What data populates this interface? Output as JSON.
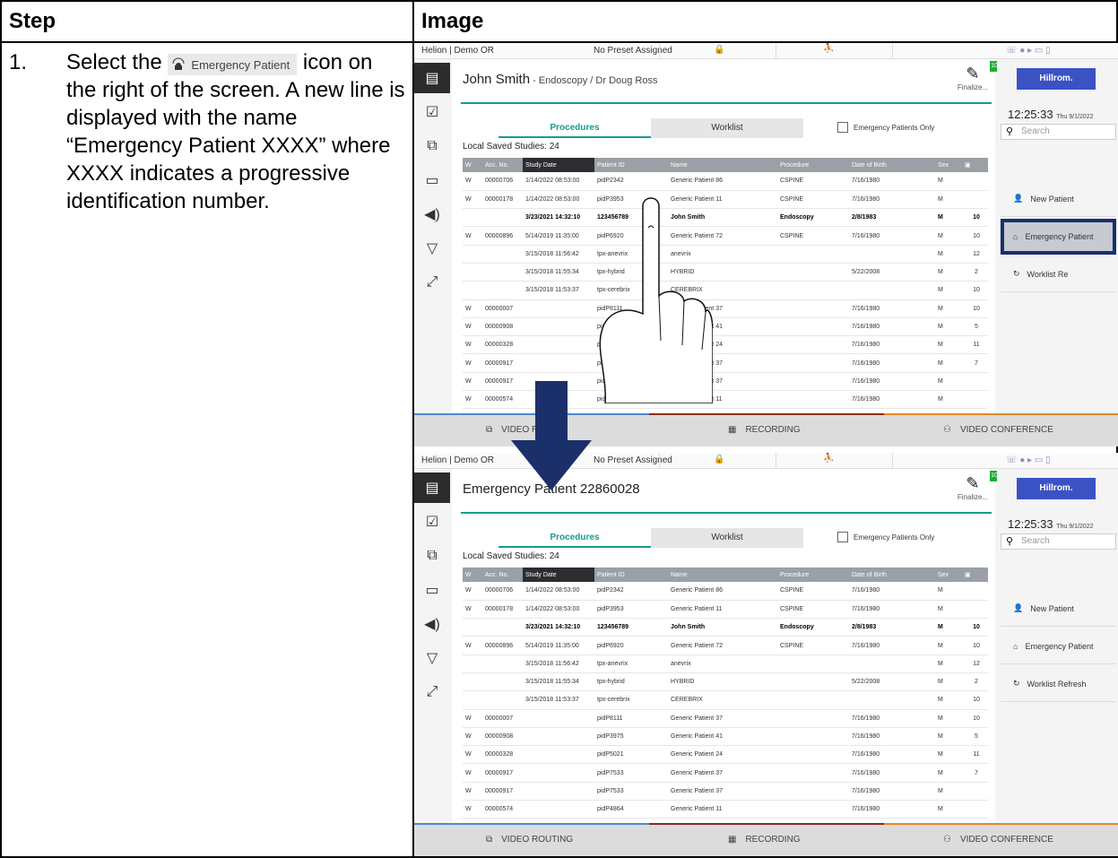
{
  "header": {
    "step": "Step",
    "image": "Image"
  },
  "step": {
    "number": "1.",
    "text_before": "Select the",
    "icon_label": "Emergency Patient",
    "text_after": "icon on the right of the screen. A new line is displayed with the name “Emergency Patient XXXX” where XXXX indicates a progressive identification number."
  },
  "ui": {
    "topbar": {
      "location": "Helion | Demo OR",
      "preset": "No Preset Assigned"
    },
    "finalize": "Finalize...",
    "badge": "10",
    "tabs": {
      "procedures": "Procedures",
      "worklist": "Worklist"
    },
    "emergency_only": "Emergency Patients Only",
    "local_saved": "Local Saved Studies: 24",
    "columns": [
      "Acc. No.",
      "Study Date",
      "Patient ID",
      "Name",
      "Procedure",
      "Date of Birth",
      "Sex"
    ],
    "w_col": "W",
    "rows": [
      [
        "W",
        "00000706",
        "1/14/2022 08:53:00",
        "pidP2342",
        "Generic Patient 86",
        "CSPINE",
        "7/16/1980",
        "M",
        ""
      ],
      [
        "W",
        "00000178",
        "1/14/2022 08:53:00",
        "pidP3953",
        "Generic Patient 11",
        "CSPINE",
        "7/16/1980",
        "M",
        ""
      ],
      [
        "",
        "",
        "3/23/2021 14:32:10",
        "123456789",
        "John Smith",
        "Endoscopy",
        "2/8/1983",
        "M",
        "10"
      ],
      [
        "W",
        "00000896",
        "5/14/2019 11:35:00",
        "pidP6920",
        "Generic Patient 72",
        "CSPINE",
        "7/16/1980",
        "M",
        "10"
      ],
      [
        "",
        "",
        "3/15/2018 11:56:42",
        "tpx-anevrix",
        "anevrix",
        "",
        "",
        "M",
        "12"
      ],
      [
        "",
        "",
        "3/15/2018 11:55:34",
        "tpx-hybrid",
        "HYBRID",
        "",
        "5/22/2008",
        "M",
        "2"
      ],
      [
        "",
        "",
        "3/15/2018 11:53:37",
        "tpx-cerebrix",
        "CEREBRIX",
        "",
        "",
        "M",
        "10"
      ],
      [
        "W",
        "00000007",
        "",
        "pidP8111",
        "Generic Patient 37",
        "",
        "7/16/1980",
        "M",
        "10"
      ],
      [
        "W",
        "00000908",
        "",
        "pidP3975",
        "Generic Patient 41",
        "",
        "7/16/1980",
        "M",
        "5"
      ],
      [
        "W",
        "00000328",
        "",
        "pidP5021",
        "Generic Patient 24",
        "",
        "7/16/1980",
        "M",
        "11"
      ],
      [
        "W",
        "00000917",
        "",
        "pidP7533",
        "Generic Patient 37",
        "",
        "7/16/1980",
        "M",
        "7"
      ],
      [
        "W",
        "00000917",
        "",
        "pidP7533",
        "Generic Patient 37",
        "",
        "7/16/1980",
        "M",
        ""
      ],
      [
        "W",
        "00000574",
        "",
        "pidP4864",
        "Generic Patient 11",
        "",
        "7/16/1980",
        "M",
        ""
      ]
    ],
    "brand": "Hillrom.",
    "clock_time": "12:25:33",
    "clock_date": "Thu 9/1/2022",
    "search_placeholder": "Search",
    "new_patient": "New Patient",
    "emergency_patient": "Emergency Patient",
    "worklist_refresh": "Worklist Refresh",
    "bottom": {
      "routing": "VIDEO ROUTING",
      "recording": "RECORDING",
      "conference": "VIDEO CONFERENCE"
    }
  },
  "shot1": {
    "patient": "John Smith",
    "details": " - Endoscopy / Dr Doug Ross",
    "worklist_refresh_clipped": "Worklist Re",
    "routing_clipped": "VIDEO RO"
  },
  "shot2": {
    "patient": "Emergency Patient 22860028",
    "details": ""
  },
  "colors": {
    "teal": "#169c8c",
    "brand_blue": "#3b52c4",
    "arrow_navy": "#1b2f6a",
    "highlight": "#c7cad3"
  }
}
